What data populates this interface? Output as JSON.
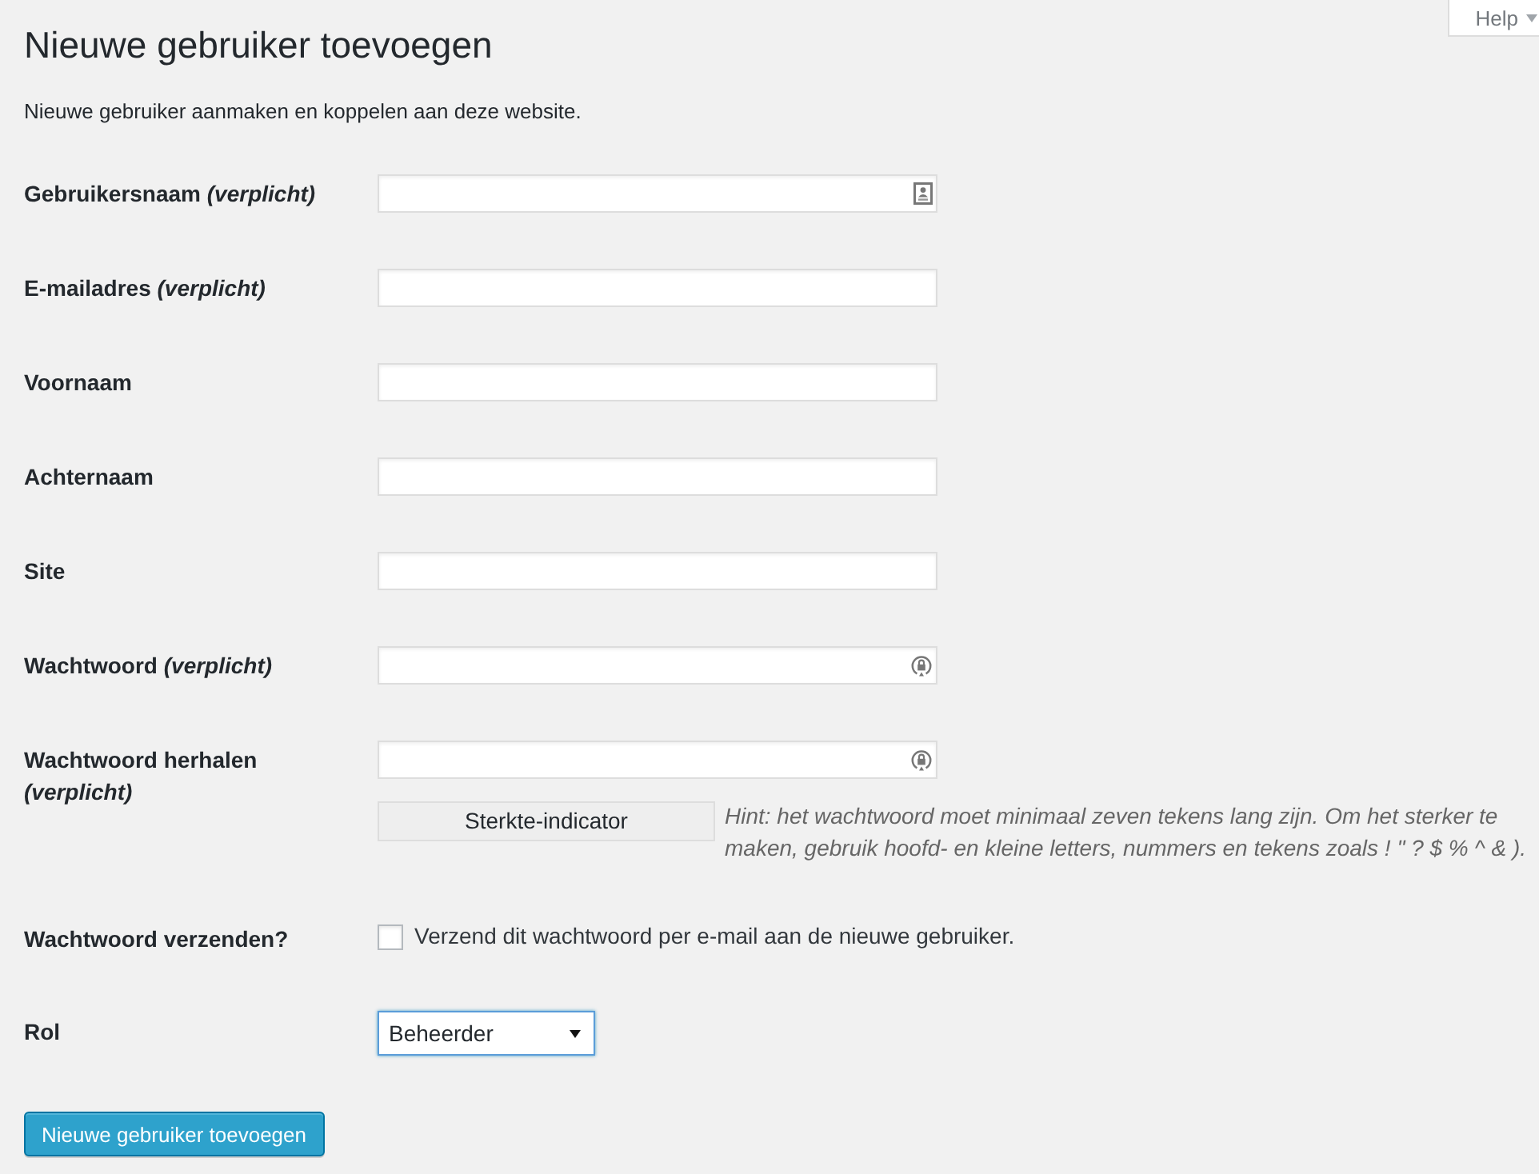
{
  "help_tab": {
    "label": "Help"
  },
  "page": {
    "title": "Nieuwe gebruiker toevoegen",
    "description": "Nieuwe gebruiker aanmaken en koppelen aan deze website."
  },
  "form": {
    "rows": [
      {
        "kind": "username",
        "label": "Gebruikersnaam *(verplicht)*"
      },
      {
        "kind": "text",
        "label": "E-mailadres *(verplicht)*"
      },
      {
        "kind": "text",
        "label": "Voornaam"
      },
      {
        "kind": "text",
        "label": "Achternaam"
      },
      {
        "kind": "text",
        "label": "Site"
      },
      {
        "kind": "password",
        "label": "Wachtwoord *(verplicht)*"
      },
      {
        "kind": "password",
        "label": "Wachtwoord herhalen *(verplicht)*",
        "strength": {
          "label": "Sterkte-indicator",
          "hint": "Hint: het wachtwoord moet minimaal zeven tekens lang zijn. Om het sterker te maken, gebruik hoofd- en kleine letters, nummers en tekens zoals ! \" ? $ % ^ & )."
        }
      },
      {
        "kind": "checkbox",
        "label": "Wachtwoord verzenden?",
        "checked": false,
        "text": "Verzend dit wachtwoord per e-mail aan de nieuwe gebruiker."
      },
      {
        "kind": "select",
        "label": "Rol",
        "value": "Beheerder",
        "focused": true
      }
    ],
    "submit": "Nieuwe gebruiker toevoegen"
  }
}
